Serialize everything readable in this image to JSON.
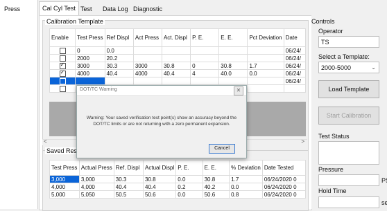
{
  "left_strip": {
    "item": "Press"
  },
  "tabs": [
    {
      "label": "Cal Cyl Test",
      "active": true
    },
    {
      "label": "Test",
      "active": false
    },
    {
      "label": "Data Log",
      "active": false
    },
    {
      "label": "Diagnostic",
      "active": false
    }
  ],
  "calibration_template": {
    "title": "Calibration Template",
    "columns": [
      "Enable",
      "Test Press",
      "Ref Displ",
      "Act Press",
      "Act. Displ",
      "P. E.",
      "E. E.",
      "Pct Deviation",
      "Date"
    ],
    "rows": [
      {
        "enabled": false,
        "cells": [
          "0",
          "0.0",
          "",
          "",
          "",
          "",
          "",
          "06/24/"
        ]
      },
      {
        "enabled": false,
        "cells": [
          "2000",
          "20.2",
          "",
          "",
          "",
          "",
          "",
          "06/24/"
        ]
      },
      {
        "enabled": true,
        "cells": [
          "3000",
          "30.3",
          "3000",
          "30.8",
          "0",
          "30.8",
          "1.7",
          "06/24/"
        ]
      },
      {
        "enabled": true,
        "cells": [
          "4000",
          "40.4",
          "4000",
          "40.4",
          "4",
          "40.0",
          "0.0",
          "06/24/"
        ]
      },
      {
        "enabled": false,
        "cells": [
          "",
          "",
          "",
          "",
          "",
          "",
          "",
          "06/24/"
        ],
        "selected": true
      },
      {
        "enabled": false,
        "cells": [
          "",
          "",
          "",
          "",
          "",
          "",
          "",
          ""
        ]
      }
    ]
  },
  "saved_results": {
    "title": "Saved Resu",
    "columns": [
      "Test Press",
      "Actual Press",
      "Ref. Displ",
      "Actual Displ",
      "P. E.",
      "E. E.",
      "% Deviation",
      "Date Tested"
    ],
    "rows": [
      {
        "cells": [
          "3,000",
          "3,000",
          "30.3",
          "30.8",
          "0.0",
          "30.8",
          "1.7",
          "06/24/2020 0"
        ],
        "selected_first": true
      },
      {
        "cells": [
          "4,000",
          "4,000",
          "40.4",
          "40.4",
          "0.2",
          "40.2",
          "0.0",
          "06/24/2020 0"
        ]
      },
      {
        "cells": [
          "5,000",
          "5,050",
          "50.5",
          "50.6",
          "0.0",
          "50.6",
          "0.8",
          "06/24/2020 0"
        ]
      }
    ]
  },
  "dialog": {
    "title": "DOT/TC Warning",
    "close_glyph": "✕",
    "message": "Warning: Your saved verification test point(s) show an accuracy beyond the DOT/TC limits or are not returning with a zero permanent expansion.",
    "cancel_label": "Cancel"
  },
  "controls": {
    "title": "Controls",
    "operator_label": "Operator",
    "operator_value": "TS",
    "template_label": "Select a Template:",
    "template_value": "2000-5000",
    "load_button": "Load Template",
    "start_button": "Start Calibration",
    "status_label": "Test Status",
    "pressure_label": "Pressure",
    "pressure_unit": "PS",
    "hold_label": "Hold Time",
    "hold_unit": "se"
  }
}
